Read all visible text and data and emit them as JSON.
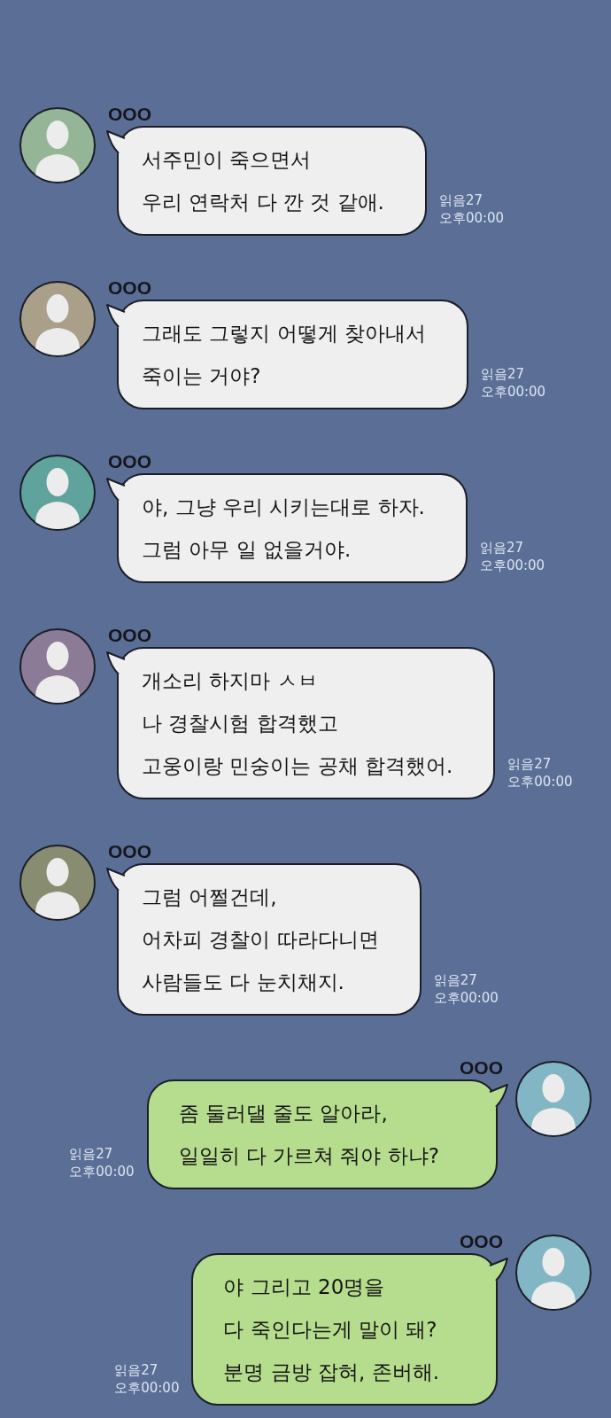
{
  "messages": [
    {
      "kind": "incoming",
      "sender": "OOO",
      "color": "#95b597",
      "text": "서주민이 죽으면서\n우리 연락처 다 깐 것 같애.",
      "read": "읽음27",
      "time": "오후00:00"
    },
    {
      "kind": "incoming",
      "sender": "OOO",
      "color": "#aa9f88",
      "text": "그래도 그렇지 어떻게 찾아내서\n죽이는 거야?",
      "read": "읽음27",
      "time": "오후00:00"
    },
    {
      "kind": "incoming",
      "sender": "OOO",
      "color": "#5fa39c",
      "text": "야, 그냥 우리 시키는대로 하자.\n그럼 아무 일 없을거야.",
      "read": "읽음27",
      "time": "오후00:00"
    },
    {
      "kind": "incoming",
      "sender": "OOO",
      "color": "#8c7b97",
      "text": "개소리 하지마 ㅅㅂ\n나 경찰시험 합격했고\n고웅이랑 민숭이는 공채 합격했어.",
      "read": "읽음27",
      "time": "오후00:00"
    },
    {
      "kind": "incoming",
      "sender": "OOO",
      "color": "#888d71",
      "text": "그럼 어쩔건데,\n어차피 경찰이 따라다니면\n사람들도 다 눈치채지.",
      "read": "읽음27",
      "time": "오후00:00"
    },
    {
      "kind": "outgoing",
      "sender": "OOO",
      "color": "#83b6c4",
      "text": "좀 둘러댈 줄도 알아라,\n일일히 다 가르쳐 줘야 하냐?",
      "read": "읽음27",
      "time": "오후00:00"
    },
    {
      "kind": "outgoing",
      "sender": "OOO",
      "color": "#83b6c4",
      "text": "야 그리고 20명을\n다 죽인다는게 말이 돼?\n분명 금방 잡혀, 존버해.",
      "read": "읽음27",
      "time": "오후00:00"
    }
  ]
}
